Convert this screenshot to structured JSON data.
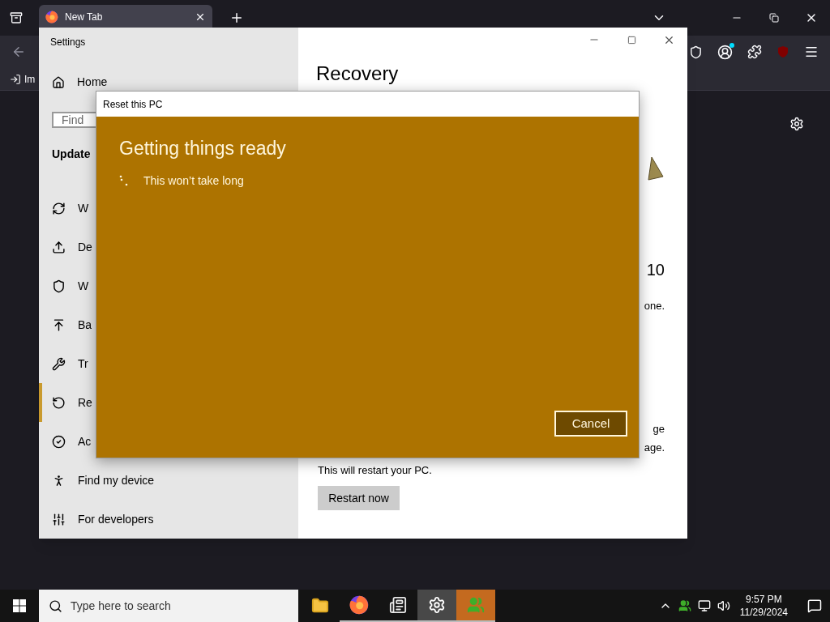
{
  "browser": {
    "tabs": [
      {
        "title": "New Tab",
        "selected": true
      }
    ],
    "bookmarks": [
      {
        "label": "Im"
      }
    ]
  },
  "settings": {
    "title": "Settings",
    "home": "Home",
    "search": {
      "placeholder": "Find"
    },
    "section": "Update",
    "nav": [
      {
        "label": "W",
        "kind": "sync",
        "selected": false
      },
      {
        "label": "De",
        "kind": "delivery",
        "selected": false
      },
      {
        "label": "W",
        "kind": "shield",
        "selected": false
      },
      {
        "label": "Ba",
        "kind": "backup",
        "selected": false
      },
      {
        "label": "Tr",
        "kind": "troubleshoot",
        "selected": false
      },
      {
        "label": "Re",
        "kind": "recovery",
        "selected": true
      },
      {
        "label": "Ac",
        "kind": "activation",
        "selected": false
      },
      {
        "label": "Find my device",
        "kind": "find",
        "selected": false
      },
      {
        "label": "For developers",
        "kind": "developers",
        "selected": false
      }
    ],
    "page_title": "Recovery",
    "fragments": [
      {
        "kind": "heading",
        "text": "10"
      },
      {
        "kind": "text",
        "text": "one."
      },
      {
        "kind": "gap"
      },
      {
        "kind": "text",
        "text": "ge"
      },
      {
        "kind": "text",
        "text": "age."
      }
    ],
    "restart_note": "This will restart your PC.",
    "restart_button": "Restart now"
  },
  "dialog": {
    "title": "Reset this PC",
    "heading": "Getting things ready",
    "status": "This won’t take long",
    "button": "Cancel"
  },
  "taskbar": {
    "search_placeholder": "Type here to search",
    "apps": [
      {
        "kind": "explorer",
        "running": false,
        "selected": false,
        "attention": false
      },
      {
        "kind": "firefox",
        "running": true,
        "selected": false,
        "attention": false
      },
      {
        "kind": "news",
        "running": true,
        "selected": false,
        "attention": false
      },
      {
        "kind": "settings",
        "running": true,
        "selected": true,
        "attention": false
      },
      {
        "kind": "people",
        "running": true,
        "selected": false,
        "attention": true
      }
    ],
    "time": "9:57 PM",
    "date": "11/29/2024"
  }
}
